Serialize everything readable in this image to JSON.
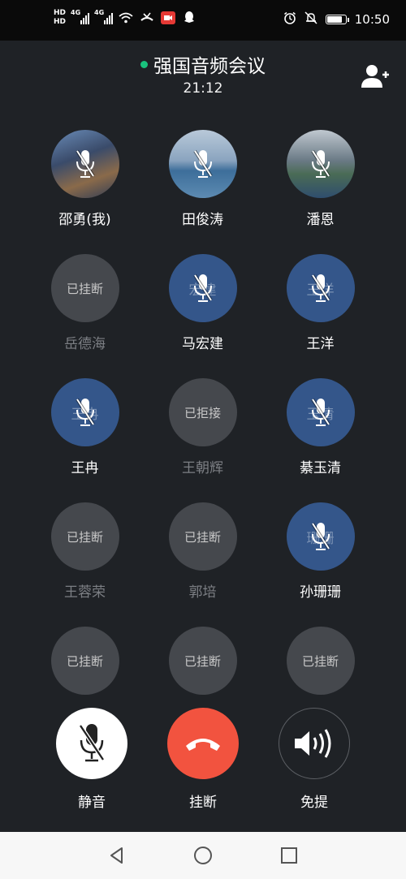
{
  "status_bar": {
    "time": "10:50",
    "hd_top": "HD",
    "hd_bottom": "HD",
    "net1": "4G",
    "net2": "4G",
    "battery_level": 0.9
  },
  "header": {
    "title": "强国音频会议",
    "timer": "21:12",
    "online_color": "#19c37d"
  },
  "participants": [
    {
      "name": "邵勇(我)",
      "avatar": "photo1",
      "muted": true,
      "state": "",
      "ghost": ""
    },
    {
      "name": "田俊涛",
      "avatar": "photo2",
      "muted": true,
      "state": "",
      "ghost": ""
    },
    {
      "name": "潘恩",
      "avatar": "photo3",
      "muted": true,
      "state": "",
      "ghost": ""
    },
    {
      "name": "岳德海",
      "avatar": "gray",
      "muted": false,
      "state": "已挂断",
      "ghost": ""
    },
    {
      "name": "马宏建",
      "avatar": "blue",
      "muted": true,
      "state": "",
      "ghost": "宏建"
    },
    {
      "name": "王洋",
      "avatar": "blue",
      "muted": true,
      "state": "",
      "ghost": "王洋"
    },
    {
      "name": "王冉",
      "avatar": "blue",
      "muted": true,
      "state": "",
      "ghost": "王冉"
    },
    {
      "name": "王朝辉",
      "avatar": "gray",
      "muted": false,
      "state": "已拒接",
      "ghost": ""
    },
    {
      "name": "綦玉清",
      "avatar": "blue",
      "muted": true,
      "state": "",
      "ghost": "玉清"
    },
    {
      "name": "王蓉荣",
      "avatar": "gray",
      "muted": false,
      "state": "已挂断",
      "ghost": ""
    },
    {
      "name": "郭培",
      "avatar": "gray",
      "muted": false,
      "state": "已挂断",
      "ghost": ""
    },
    {
      "name": "孙珊珊",
      "avatar": "blue",
      "muted": true,
      "state": "",
      "ghost": "珊珊"
    },
    {
      "name": "",
      "avatar": "gray",
      "muted": false,
      "state": "已挂断",
      "ghost": ""
    },
    {
      "name": "",
      "avatar": "gray",
      "muted": false,
      "state": "已挂断",
      "ghost": ""
    },
    {
      "name": "",
      "avatar": "gray",
      "muted": false,
      "state": "已挂断",
      "ghost": ""
    }
  ],
  "controls": {
    "mute_label": "静音",
    "hangup_label": "挂断",
    "speaker_label": "免提",
    "hangup_color": "#f2533f"
  },
  "nav": {
    "back_icon": "triangle-back-icon",
    "home_icon": "circle-home-icon",
    "recents_icon": "square-recents-icon"
  }
}
